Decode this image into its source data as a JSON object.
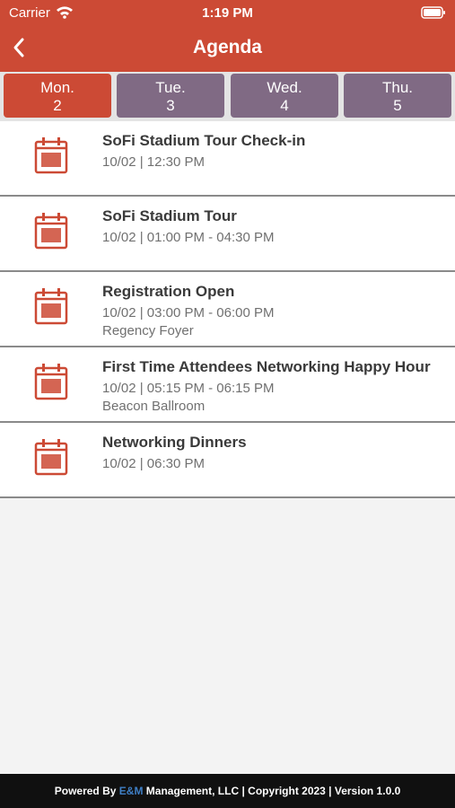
{
  "status": {
    "carrier": "Carrier",
    "time": "1:19 PM"
  },
  "nav": {
    "title": "Agenda"
  },
  "days": [
    {
      "name": "Mon.",
      "num": "2"
    },
    {
      "name": "Tue.",
      "num": "3"
    },
    {
      "name": "Wed.",
      "num": "4"
    },
    {
      "name": "Thu.",
      "num": "5"
    }
  ],
  "events": [
    {
      "title": "SoFi Stadium Tour Check-in",
      "time": "10/02 | 12:30 PM",
      "location": ""
    },
    {
      "title": "SoFi Stadium Tour",
      "time": "10/02 | 01:00 PM - 04:30 PM",
      "location": ""
    },
    {
      "title": "Registration Open",
      "time": "10/02 | 03:00 PM - 06:00 PM",
      "location": "Regency Foyer"
    },
    {
      "title": "First Time Attendees Networking Happy Hour",
      "time": "10/02 | 05:15 PM - 06:15 PM",
      "location": "Beacon Ballroom"
    },
    {
      "title": "Networking Dinners",
      "time": "10/02 | 06:30 PM",
      "location": ""
    }
  ],
  "footer": {
    "prefix": "Powered By ",
    "brand": "E&M",
    "suffix": " Management, LLC | Copyright 2023 | Version 1.0.0"
  },
  "colors": {
    "accent": "#cc4a35",
    "tab_inactive": "#806a84"
  }
}
